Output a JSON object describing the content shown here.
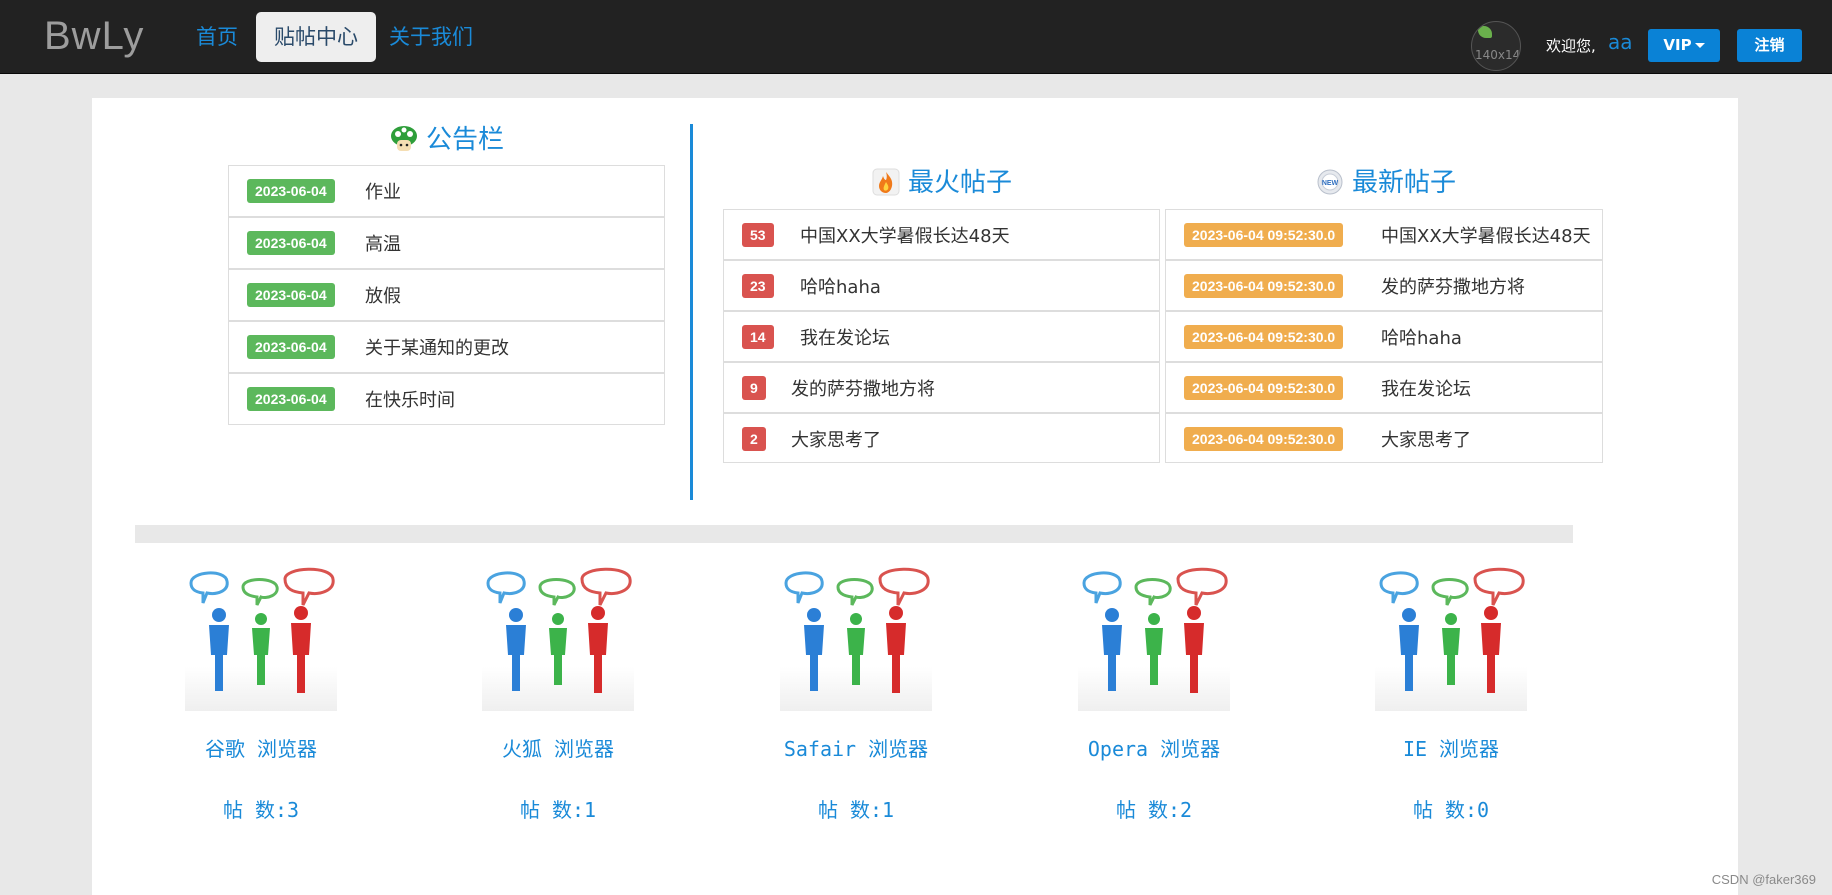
{
  "navbar": {
    "brand": "BwLy",
    "items": [
      {
        "label": "首页"
      },
      {
        "label": "贴帖中心"
      },
      {
        "label": "关于我们"
      }
    ],
    "avatar_alt": "140x140",
    "welcome": "欢迎您,",
    "username": "aa",
    "vip_label": "VIP",
    "logout_label": "注销"
  },
  "announcements": {
    "title": "公告栏",
    "items": [
      {
        "date": "2023-06-04",
        "text": "作业"
      },
      {
        "date": "2023-06-04",
        "text": "高温"
      },
      {
        "date": "2023-06-04",
        "text": "放假"
      },
      {
        "date": "2023-06-04",
        "text": "关于某通知的更改"
      },
      {
        "date": "2023-06-04",
        "text": "在快乐时间"
      }
    ]
  },
  "hot_posts": {
    "title": "最火帖子",
    "items": [
      {
        "count": "53",
        "text": "中国XX大学暑假长达48天"
      },
      {
        "count": "23",
        "text": "哈哈haha"
      },
      {
        "count": "14",
        "text": "我在发论坛"
      },
      {
        "count": "9",
        "text": "发的萨芬撒地方将"
      },
      {
        "count": "2",
        "text": "大家思考了"
      }
    ]
  },
  "new_posts": {
    "title": "最新帖子",
    "items": [
      {
        "time": "2023-06-04 09:52:30.0",
        "text": "中国XX大学暑假长达48天"
      },
      {
        "time": "2023-06-04 09:52:30.0",
        "text": "发的萨芬撒地方将"
      },
      {
        "time": "2023-06-04 09:52:30.0",
        "text": "哈哈haha"
      },
      {
        "time": "2023-06-04 09:52:30.0",
        "text": "我在发论坛"
      },
      {
        "time": "2023-06-04 09:52:30.0",
        "text": "大家思考了"
      }
    ]
  },
  "browsers": [
    {
      "name": "谷歌 浏览器",
      "count": "帖 数:3"
    },
    {
      "name": "火狐 浏览器",
      "count": "帖 数:1"
    },
    {
      "name": "Safair 浏览器",
      "count": "帖 数:1"
    },
    {
      "name": "Opera 浏览器",
      "count": "帖 数:2"
    },
    {
      "name": "IE 浏览器",
      "count": "帖 数:0"
    }
  ],
  "watermark": "CSDN @faker369"
}
